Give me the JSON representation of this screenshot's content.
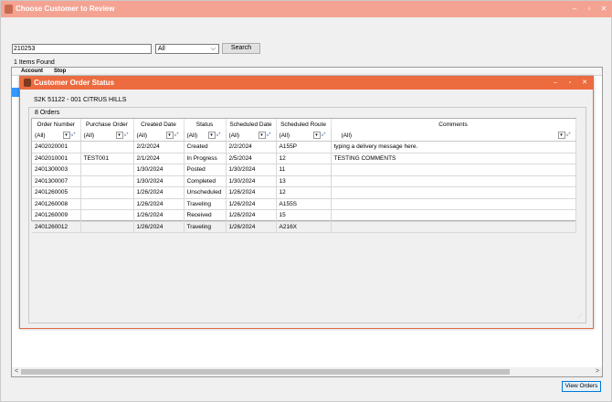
{
  "window": {
    "title": "Choose Customer to Review",
    "btn_min": "–",
    "btn_max": "▫",
    "btn_close": "✕"
  },
  "search": {
    "value": "210253",
    "filter_value": "All",
    "button": "Search"
  },
  "results": {
    "count_label": "1 Items Found",
    "columns": [
      "Account",
      "Stop"
    ]
  },
  "scroll": {
    "left": "<",
    "right": ">"
  },
  "actions": {
    "view_orders": "View Orders"
  },
  "modal": {
    "title": "Customer Order Status",
    "btn_min": "–",
    "btn_max": "▫",
    "btn_close": "✕",
    "customer": "S2K 51122 - 001 CITRUS HILLS",
    "orders_count": "8 Orders",
    "columns": [
      "Order Number",
      "Purchase Order",
      "Created Date",
      "Status",
      "Scheduled Date",
      "Scheduled Route",
      "Comments"
    ],
    "filter_value": "(All)",
    "rows": [
      [
        "2402020001",
        "",
        "2/2/2024",
        "Created",
        "2/2/2024",
        "A155P",
        "typing a delivery message here."
      ],
      [
        "2402010001",
        "TEST001",
        "2/1/2024",
        "In Progress",
        "2/5/2024",
        "12",
        "TESTING COMMENTS"
      ],
      [
        "2401300003",
        "",
        "1/30/2024",
        "Posted",
        "1/30/2024",
        "11",
        ""
      ],
      [
        "2401300007",
        "",
        "1/30/2024",
        "Completed",
        "1/30/2024",
        "13",
        ""
      ],
      [
        "2401260005",
        "",
        "1/26/2024",
        "Unscheduled",
        "1/26/2024",
        "12",
        ""
      ],
      [
        "2401260008",
        "",
        "1/26/2024",
        "Traveling",
        "1/26/2024",
        "A155S",
        ""
      ],
      [
        "2401260009",
        "",
        "1/26/2024",
        "Received",
        "1/26/2024",
        "15",
        ""
      ],
      [
        "2401260012",
        "",
        "1/26/2024",
        "Traveling",
        "1/26/2024",
        "A216X",
        ""
      ]
    ]
  }
}
